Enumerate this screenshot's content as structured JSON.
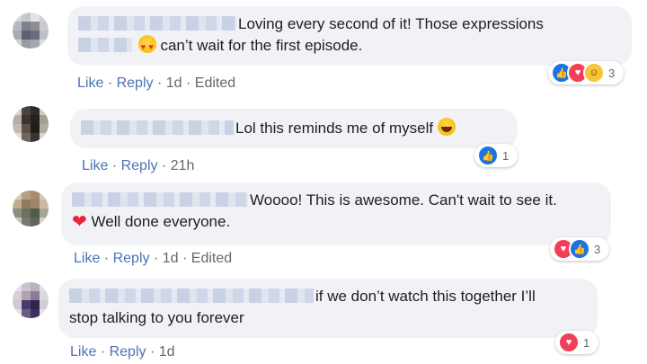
{
  "comments": [
    {
      "text_line1": "Loving every second of it! Those expressions",
      "text_line2": "can’t wait for the first episode.",
      "actions": {
        "like": "Like",
        "reply": "Reply",
        "time": "1d",
        "edited": "Edited"
      },
      "reactions": {
        "icons": [
          "like-icon",
          "love-icon",
          "haha-icon"
        ],
        "count": "3"
      }
    },
    {
      "text_line1": "Lol this reminds me of myself",
      "actions": {
        "like": "Like",
        "reply": "Reply",
        "time": "21h"
      },
      "reactions": {
        "icons": [
          "like-icon"
        ],
        "count": "1"
      }
    },
    {
      "text_line1": "Woooo! This is awesome. Can't wait to see it.",
      "text_line2": "Well done everyone.",
      "actions": {
        "like": "Like",
        "reply": "Reply",
        "time": "1d",
        "edited": "Edited"
      },
      "reactions": {
        "icons": [
          "love-icon",
          "like-icon"
        ],
        "count": "3"
      }
    },
    {
      "text_line1": "if we don’t watch this together I’ll",
      "text_line2": "stop talking to you forever",
      "actions": {
        "like": "Like",
        "reply": "Reply",
        "time": "1d"
      },
      "reactions": {
        "icons": [
          "love-icon"
        ],
        "count": "1"
      }
    }
  ],
  "colors": {
    "bubble": "#f0f2f5",
    "link": "#4b74b4",
    "meta": "#65676b",
    "like": "#1b74e4",
    "love": "#f33e58"
  }
}
